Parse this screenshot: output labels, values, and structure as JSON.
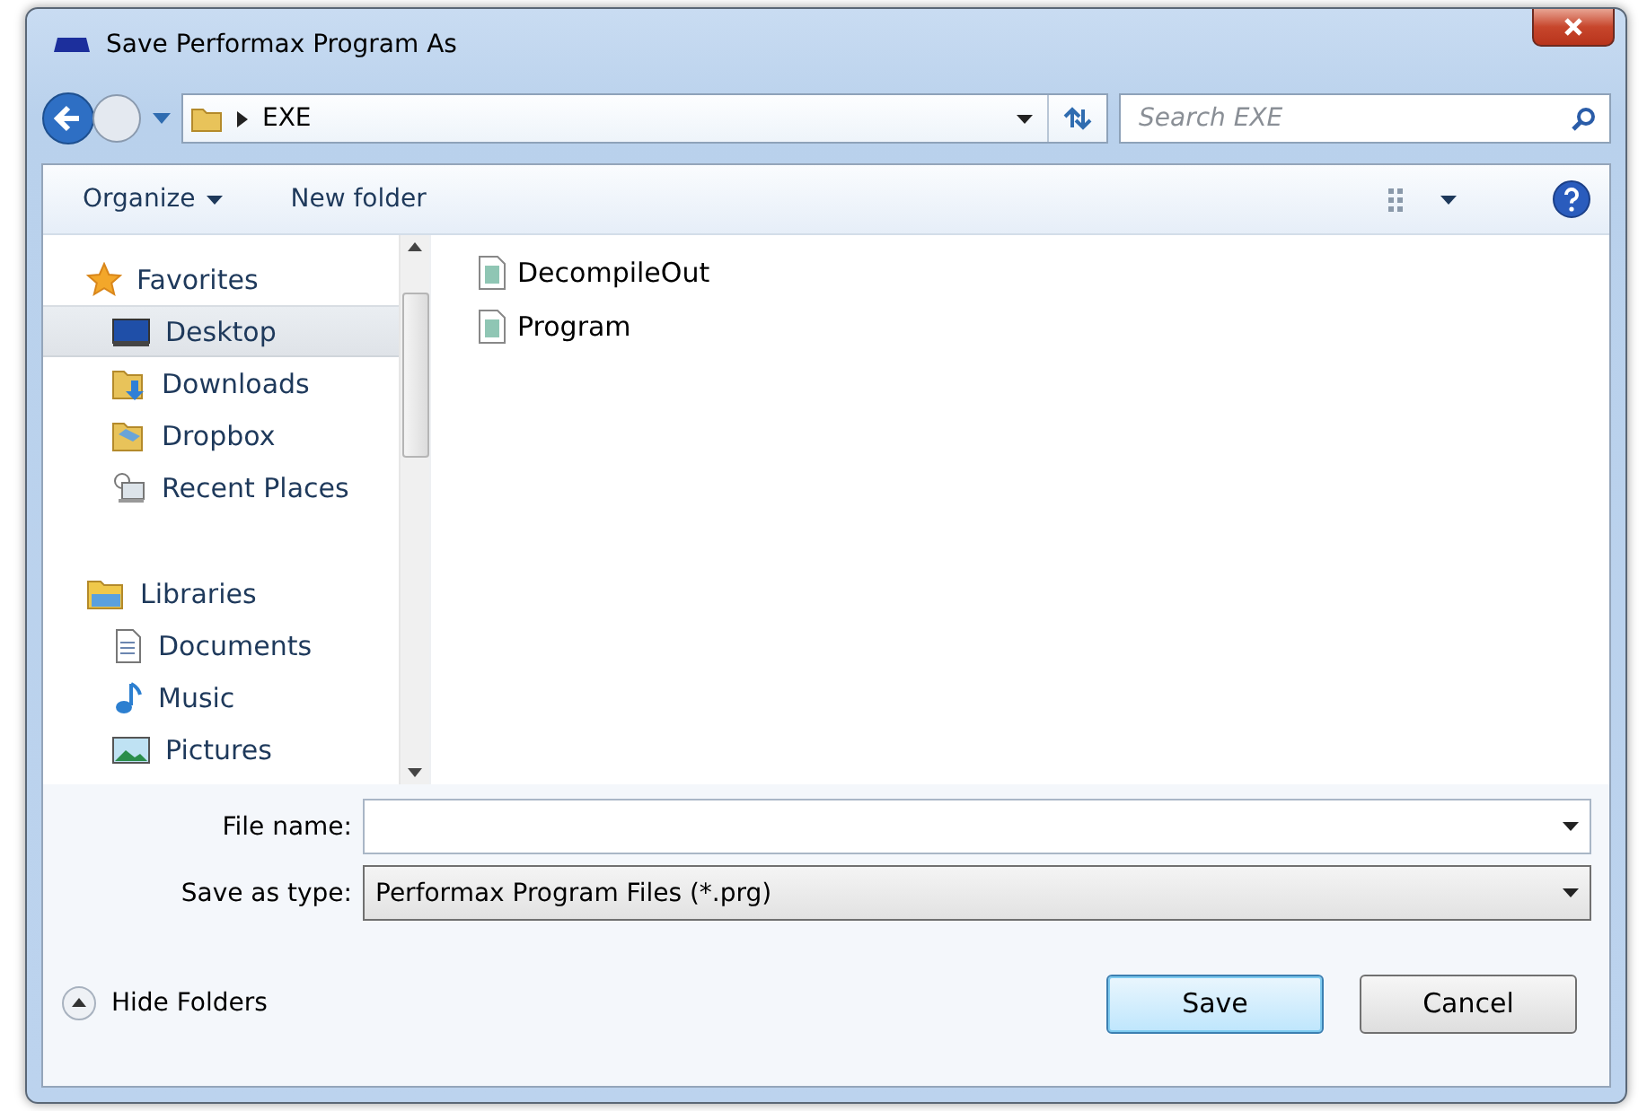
{
  "window": {
    "title": "Save Performax Program As"
  },
  "address_bar": {
    "path": [
      "EXE"
    ]
  },
  "search": {
    "placeholder": "Search EXE"
  },
  "toolbar": {
    "buttons": [
      {
        "label": "Organize",
        "dropdown": true
      },
      {
        "label": "New folder",
        "dropdown": false
      }
    ]
  },
  "sidebar": {
    "groups": [
      {
        "label": "Favorites",
        "children": [
          {
            "label": "Desktop",
            "selected": true
          },
          {
            "label": "Downloads",
            "selected": false
          },
          {
            "label": "Dropbox",
            "selected": false
          },
          {
            "label": "Recent Places",
            "selected": false
          }
        ]
      },
      {
        "label": "Libraries",
        "children": [
          {
            "label": "Documents",
            "selected": false
          },
          {
            "label": "Music",
            "selected": false
          },
          {
            "label": "Pictures",
            "selected": false
          }
        ]
      }
    ]
  },
  "files": [
    {
      "name": "DecompileOut"
    },
    {
      "name": "Program"
    }
  ],
  "file_name": {
    "label": "File name:"
  },
  "save_as_type": {
    "label": "Save as type:",
    "value": "Performax Program Files (*.prg)"
  },
  "hide_folders": "Hide Folders",
  "buttons": [
    {
      "label": "Save",
      "default": true
    },
    {
      "label": "Cancel",
      "default": false
    }
  ]
}
